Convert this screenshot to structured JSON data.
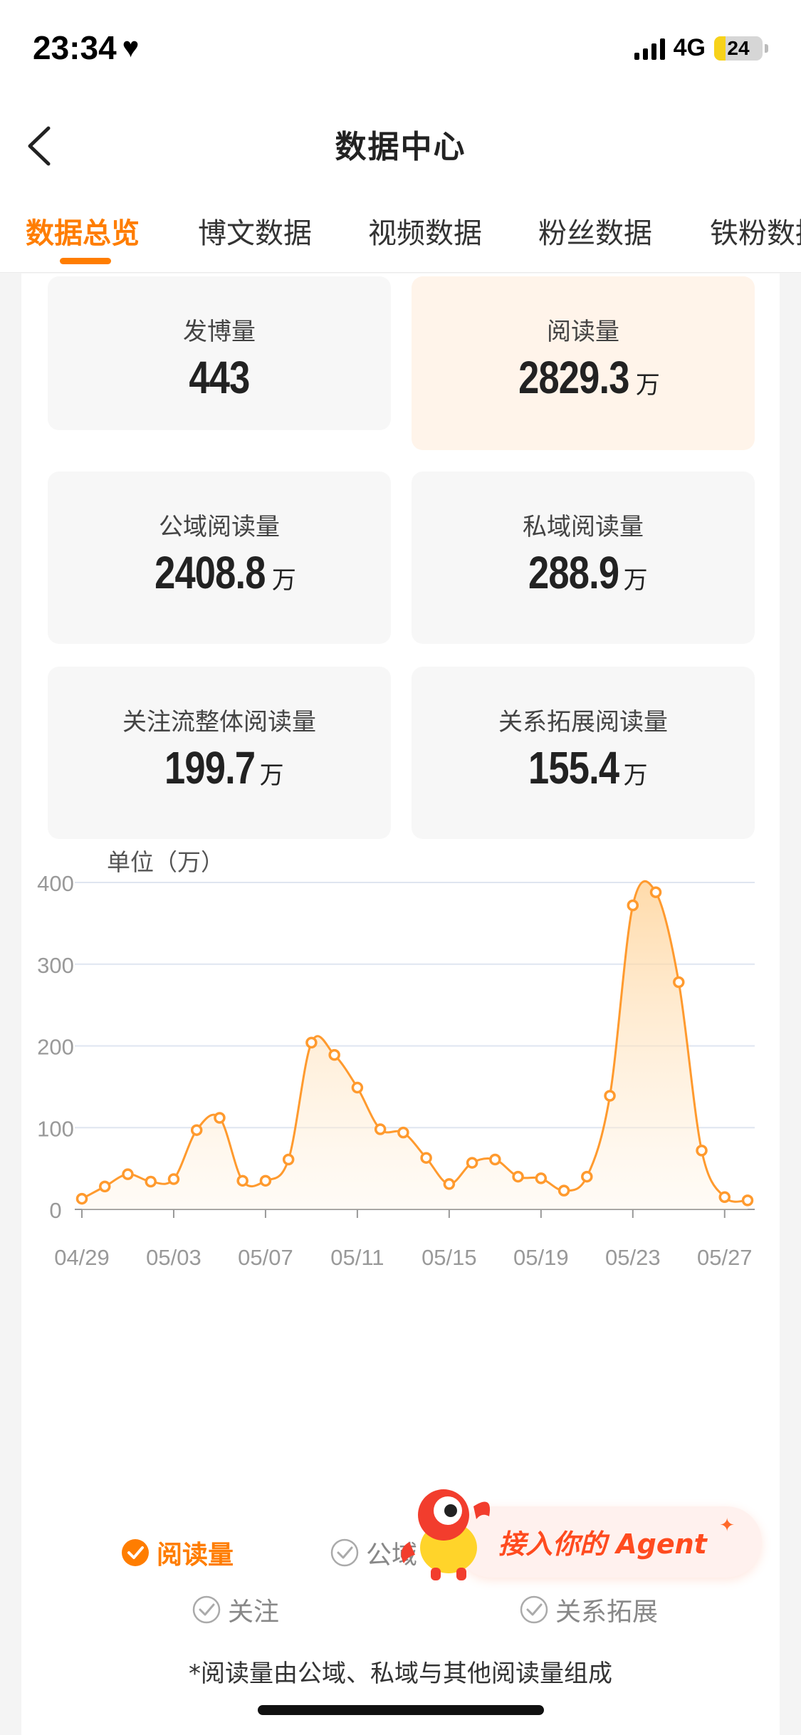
{
  "status_bar": {
    "time": "23:34",
    "network": "4G",
    "battery": "24",
    "battery_level": 0.24
  },
  "nav": {
    "title": "数据中心"
  },
  "tabs": [
    {
      "label": "数据总览",
      "active": true
    },
    {
      "label": "博文数据",
      "active": false
    },
    {
      "label": "视频数据",
      "active": false
    },
    {
      "label": "粉丝数据",
      "active": false
    },
    {
      "label": "铁粉数据",
      "active": false
    }
  ],
  "stats": [
    {
      "label": "发博量",
      "value": "443",
      "unit": ""
    },
    {
      "label": "阅读量",
      "value": "2829.3",
      "unit": "万"
    },
    {
      "label": "公域阅读量",
      "value": "2408.8",
      "unit": "万"
    },
    {
      "label": "私域阅读量",
      "value": "288.9",
      "unit": "万"
    },
    {
      "label": "关注流整体阅读量",
      "value": "199.7",
      "unit": "万"
    },
    {
      "label": "关系拓展阅读量",
      "value": "155.4",
      "unit": "万"
    }
  ],
  "chart_data": {
    "type": "area",
    "ylabel": "单位（万）",
    "ylim": [
      0,
      400
    ],
    "yticks": [
      "400",
      "300",
      "200",
      "100",
      "0"
    ],
    "xtick_labels": [
      "04/29",
      "05/03",
      "05/07",
      "05/11",
      "05/15",
      "05/19",
      "05/23",
      "05/27"
    ],
    "x": [
      "04/29",
      "04/30",
      "05/01",
      "05/02",
      "05/03",
      "05/04",
      "05/05",
      "05/06",
      "05/07",
      "05/08",
      "05/09",
      "05/10",
      "05/11",
      "05/12",
      "05/13",
      "05/14",
      "05/15",
      "05/16",
      "05/17",
      "05/18",
      "05/19",
      "05/20",
      "05/21",
      "05/22",
      "05/23",
      "05/24",
      "05/25",
      "05/26",
      "05/27",
      "05/28"
    ],
    "series": [
      {
        "name": "阅读量",
        "color": "#ff9a2e",
        "values": [
          13,
          28,
          43,
          34,
          37,
          97,
          112,
          35,
          35,
          61,
          204,
          189,
          149,
          98,
          94,
          63,
          31,
          57,
          61,
          40,
          38,
          23,
          40,
          139,
          372,
          388,
          278,
          72,
          15,
          11
        ]
      }
    ],
    "grid": true,
    "legend": [
      {
        "label": "阅读量",
        "checked": true
      },
      {
        "label": "公域",
        "checked": false
      },
      {
        "label": "关注",
        "checked": false
      },
      {
        "label": "关系拓展",
        "checked": false
      }
    ]
  },
  "footnote": "*阅读量由公域、私域与其他阅读量组成",
  "agent_banner": {
    "text": "接入你的 Agent"
  },
  "icons": {
    "back": "chevron-left-icon",
    "heart": "heart-icon",
    "check": "check-circle-icon",
    "mascot": "mascot-icon"
  },
  "colors": {
    "accent": "#ff7d00",
    "line": "#ff9a2e"
  }
}
